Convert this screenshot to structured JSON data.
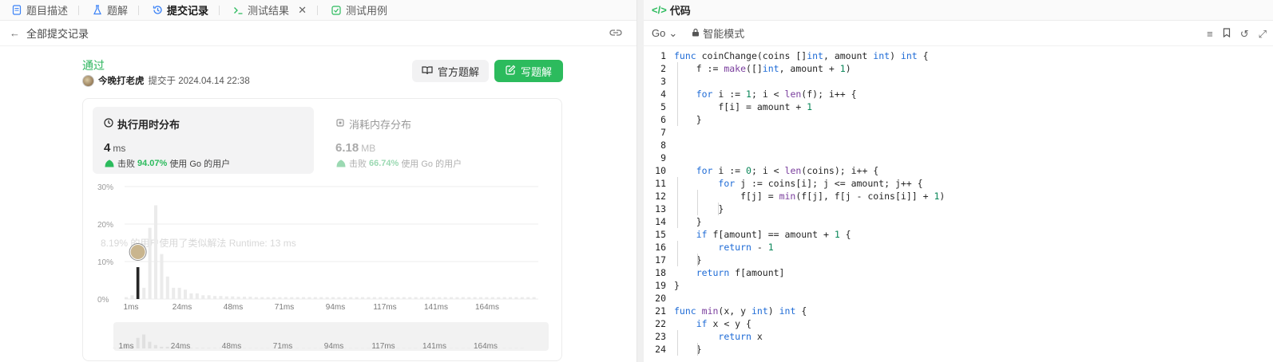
{
  "left_tabs": [
    {
      "label": "题目描述",
      "icon": "document-icon"
    },
    {
      "label": "题解",
      "icon": "flask-icon"
    },
    {
      "label": "提交记录",
      "icon": "history-icon"
    },
    {
      "label": "测试结果",
      "icon": "terminal-icon"
    },
    {
      "label": "测试用例",
      "icon": "check-square-icon"
    }
  ],
  "subbar": {
    "back_label": "全部提交记录"
  },
  "submission": {
    "status": "通过",
    "author": "今晚打老虎",
    "submitted_text": "提交于 2024.04.14 22:38"
  },
  "buttons": {
    "official": "官方题解",
    "write": "写题解"
  },
  "runtime": {
    "title": "执行用时分布",
    "value": "4",
    "unit": "ms",
    "beat_label": "击败",
    "beat_pct": "94.07%",
    "beat_suffix": "使用 Go 的用户"
  },
  "memory": {
    "title": "消耗内存分布",
    "value": "6.18",
    "unit": "MB",
    "beat_label": "击败",
    "beat_pct": "66.74%",
    "beat_suffix": "使用 Go 的用户"
  },
  "ghost_text": "8.19% 的用户使用了类似解法 Runtime: 13 ms",
  "chart_data": {
    "type": "bar",
    "yticks": [
      "30%",
      "20%",
      "10%",
      "0%"
    ],
    "ylim": [
      0,
      30
    ],
    "xticks": [
      "1ms",
      "24ms",
      "48ms",
      "71ms",
      "94ms",
      "117ms",
      "141ms",
      "164ms"
    ],
    "values": [
      0.5,
      1,
      8.5,
      3,
      19,
      25,
      12,
      6,
      3,
      3,
      2.5,
      1.5,
      1.5,
      1,
      1,
      0.8,
      0.8,
      0.7,
      0.7,
      0.6,
      0.6,
      0.6,
      0.5,
      0.5,
      0.5,
      0.5,
      0.5,
      0.5,
      0.5,
      0.5,
      0.5,
      0.5,
      0.5,
      0.5,
      0.5,
      0.5,
      0.5,
      0.5,
      0.5,
      0.5,
      0.5,
      0.5,
      0.5,
      0.5,
      0.5,
      0.5,
      0.5,
      0.5,
      0.5,
      0.5,
      0.5,
      0.5,
      0.5,
      0.5,
      0.5,
      0.5,
      0.5,
      0.5,
      0.5,
      0.5,
      0.5,
      0.5,
      0.5,
      0.5,
      0.5,
      0.5,
      0.5,
      0.5,
      0.5,
      0.5
    ],
    "highlight_index": 2,
    "colors": {
      "bar": "#ebebeb",
      "highlight": "#262626",
      "grid": "#ececec"
    }
  },
  "code_panel": {
    "title": "代码",
    "lang": "Go",
    "mode": "智能模式"
  },
  "code_lines": [
    "func coinChange(coins []int, amount int) int {",
    "    f := make([]int, amount + 1)",
    "",
    "    for i := 1; i < len(f); i++ {",
    "        f[i] = amount + 1",
    "    }",
    "",
    "",
    "",
    "    for i := 0; i < len(coins); i++ {",
    "        for j := coins[i]; j <= amount; j++ {",
    "            f[j] = min(f[j], f[j - coins[i]] + 1)",
    "        }",
    "    }",
    "    if f[amount] == amount + 1 {",
    "        return - 1",
    "    }",
    "    return f[amount]",
    "}",
    "",
    "func min(x, y int) int {",
    "    if x < y {",
    "        return x",
    "    }"
  ]
}
